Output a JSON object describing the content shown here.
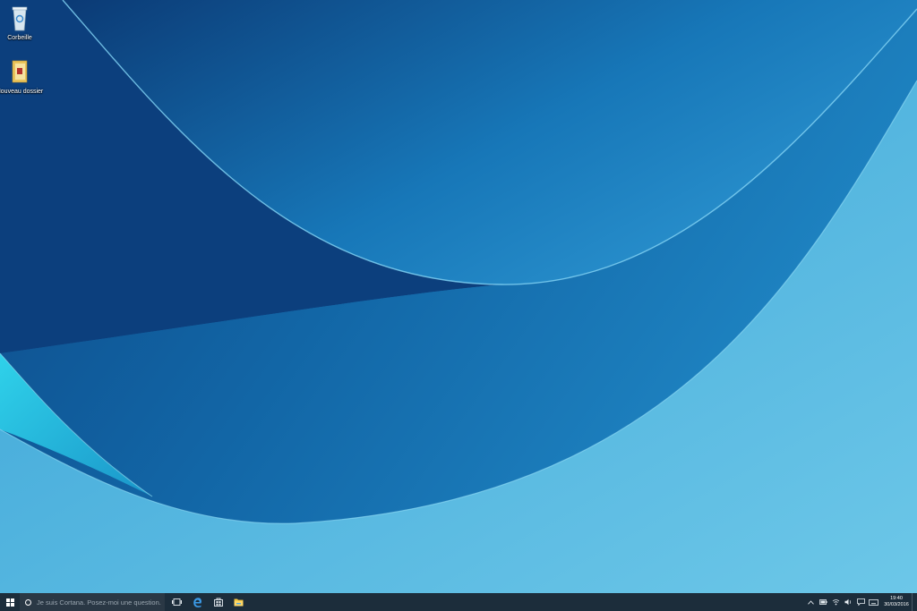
{
  "desktop": {
    "icons": [
      {
        "label": "Corbeille",
        "icon": "recycle-bin-icon"
      },
      {
        "label": "Nouveau dossier",
        "icon": "folder-icon"
      }
    ]
  },
  "taskbar": {
    "search_placeholder": "Je suis Cortana. Posez-moi une question.",
    "pinned": [
      "task-view-icon",
      "edge-icon",
      "store-icon",
      "file-explorer-icon"
    ],
    "tray": [
      "chevron-up-icon",
      "battery-icon",
      "network-icon",
      "volume-icon",
      "action-center-icon",
      "keyboard-icon"
    ],
    "clock": {
      "time": "19:40",
      "date": "30/03/2016"
    }
  },
  "colors": {
    "wallpaper_deep": "#0d3f7c",
    "wallpaper_mid": "#1b6fae",
    "wallpaper_light": "#55b8e0",
    "taskbar": "#1c2d3b",
    "edge_blue": "#3b9be8"
  }
}
